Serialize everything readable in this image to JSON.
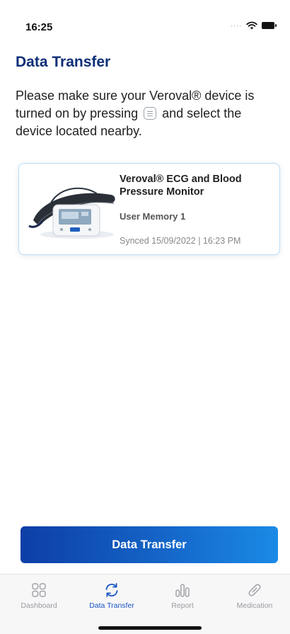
{
  "status_bar": {
    "time": "16:25"
  },
  "header": {
    "title": "Data Transfer"
  },
  "instructions": {
    "before_icon": "Please make sure your Veroval® device is turned on by pressing",
    "after_icon": "and select the device located nearby.",
    "inline_icon": "menu-button-icon"
  },
  "device": {
    "name": "Veroval® ECG and Blood Pressure Monitor",
    "memory": "User Memory 1",
    "synced": "Synced 15/09/2022 | 16:23 PM"
  },
  "action": {
    "label": "Data Transfer"
  },
  "tabs": [
    {
      "label": "Dashboard",
      "icon": "dashboard-grid-icon",
      "active": false
    },
    {
      "label": "Data Transfer",
      "icon": "sync-icon",
      "active": true
    },
    {
      "label": "Report",
      "icon": "bar-chart-icon",
      "active": false
    },
    {
      "label": "Medication",
      "icon": "pill-icon",
      "active": false
    }
  ],
  "colors": {
    "title": "#0d2f78",
    "accent": "#1a55c4",
    "button_start": "#0d3ea6",
    "button_end": "#1a8ae6",
    "card_border": "#b9dcf4"
  }
}
